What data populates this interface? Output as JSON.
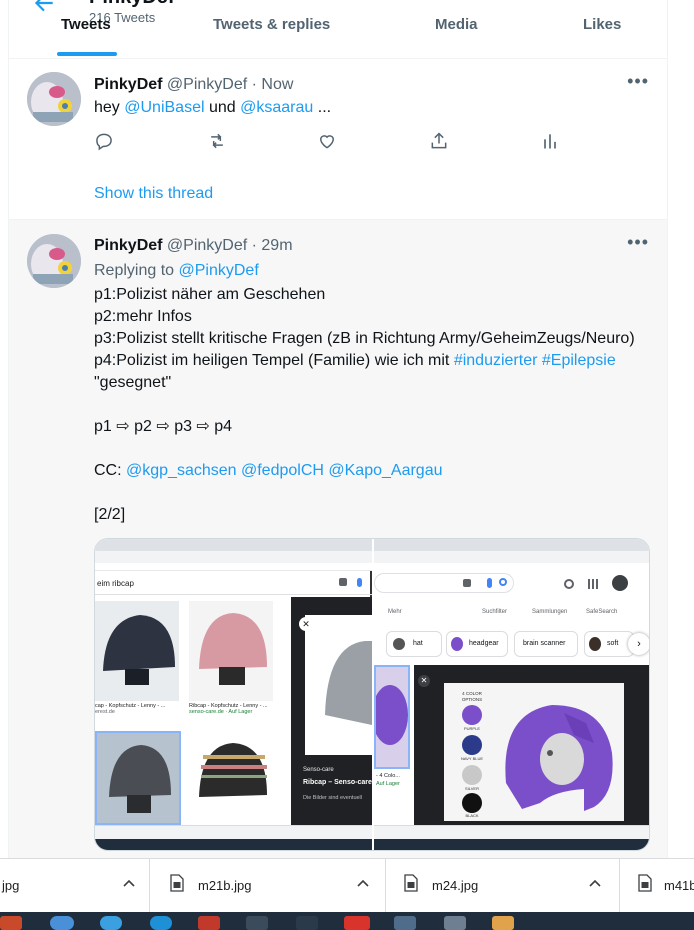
{
  "header": {
    "profile_name": "PinkyDef",
    "tweet_count": "216 Tweets",
    "tabs": [
      "Tweets",
      "Tweets & replies",
      "Media",
      "Likes"
    ]
  },
  "tweet1": {
    "name": "PinkyDef",
    "meta": "@PinkyDef · Now",
    "text_prefix": "hey ",
    "mention1": "@UniBasel",
    "text_mid": " und ",
    "mention2": "@ksaarau",
    "text_suffix": " ...",
    "show_thread": "Show this thread"
  },
  "tweet2": {
    "name": "PinkyDef",
    "meta": "@PinkyDef · 29m",
    "replying_prefix": "Replying to ",
    "replying_to": "@PinkyDef",
    "line1": "p1:Polizist näher am Geschehen",
    "line2": "p2:mehr Infos",
    "line3": "p3:Polizist stellt kritische Fragen (zB in Richtung Army/GeheimZeugs/Neuro)",
    "line4_prefix": "p4:Polizist im heiligen Tempel (Familie) wie ich mit ",
    "hashtag1": "#induzierter",
    "hashtag2": "#Epilepsie",
    "line5": "\"gesegnet\"",
    "line6": "p1 ⇨ p2 ⇨ p3 ⇨ p4",
    "cc_prefix": "CC: ",
    "cc1": "@kgp_sachsen",
    "cc2": "@fedpolCH",
    "cc3": "@Kapo_Aargau",
    "footer": "[2/2]"
  },
  "media": {
    "left_search": "eim ribcap",
    "left_caption1": "cap - Kopfschutz - Lenny - ...",
    "left_caption1_src": "erest.de",
    "left_caption2": "Ribcap - Kopfschutz - Lenny - ...",
    "left_caption2_src": "senso-care.de · Auf Lager",
    "left_panel_src": "Senso-care",
    "left_panel_title": "Ribcap – Senso-care",
    "left_panel_sub": "Die Bilder sind eventuell",
    "right_menu": "Mehr",
    "right_filter1": "Suchfilter",
    "right_filter2": "Sammlungen",
    "right_filter3": "SafeSearch",
    "chips": [
      "hat",
      "headgear",
      "brain scanner",
      "soft"
    ],
    "right_caption": "- 4 Colo...",
    "right_caption_src": "Auf Lager",
    "options_title": "4 COLOR OPTIONS",
    "options": [
      "PURPLE",
      "NAVY BLUE",
      "SILVER",
      "BLACK"
    ]
  },
  "downloads": [
    {
      "name": "jpg"
    },
    {
      "name": "m21b.jpg"
    },
    {
      "name": "m24.jpg"
    },
    {
      "name": "m41b"
    }
  ],
  "colors": {
    "accent": "#1d9bf0",
    "purple": "#7b4fc9"
  }
}
